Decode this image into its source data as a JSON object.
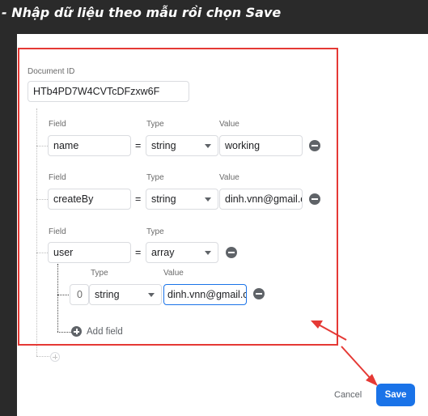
{
  "header": {
    "title": "- Nhập dữ liệu theo mẫu rồi chọn Save"
  },
  "document": {
    "id_label": "Document ID",
    "id_value": "HTb4PD7W4CVTcDFzxw6F"
  },
  "fields": [
    {
      "field_label": "Field",
      "type_label": "Type",
      "value_label": "Value",
      "name": "name",
      "type": "string",
      "value": "working"
    },
    {
      "field_label": "Field",
      "type_label": "Type",
      "value_label": "Value",
      "name": "createBy",
      "type": "string",
      "value": "dinh.vnn@gmail.com"
    },
    {
      "field_label": "Field",
      "type_label": "Type",
      "name": "user",
      "type": "array",
      "items": [
        {
          "type_label": "Type",
          "value_label": "Value",
          "index": "0",
          "type": "string",
          "value": "dinh.vnn@gmail.com"
        }
      ],
      "add_field_label": "Add field"
    }
  ],
  "footer": {
    "cancel_label": "Cancel",
    "save_label": "Save"
  },
  "annotation": {
    "highlight_color": "#e53935"
  }
}
